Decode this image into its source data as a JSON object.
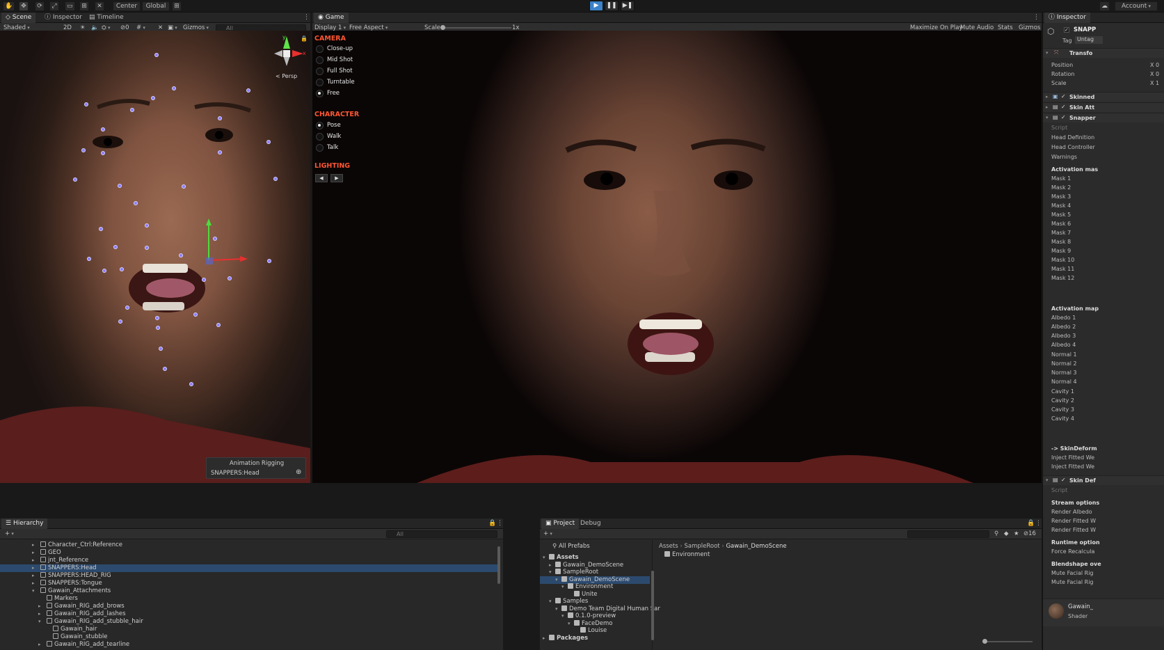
{
  "topbar": {
    "center_label": "Center",
    "global_label": "Global",
    "account_label": "Account"
  },
  "scene_tabs": [
    "Scene",
    "Inspector",
    "Timeline"
  ],
  "scene_toolbar": {
    "shading": "Shaded",
    "mode2d": "2D",
    "gizmo_count": "0",
    "gizmos": "Gizmos",
    "search_placeholder": "All"
  },
  "scene_view": {
    "persp_label": "Persp",
    "axis_y": "y",
    "axis_x": "x",
    "overlay_title": "Animation Rigging",
    "overlay_item": "SNAPPERS:Head"
  },
  "game_tab": "Game",
  "game_toolbar": {
    "display": "Display 1",
    "aspect": "Free Aspect",
    "scale_label": "Scale",
    "scale_value": "1x",
    "maximize": "Maximize On Play",
    "mute": "Mute Audio",
    "stats": "Stats",
    "gizmos": "Gizmos"
  },
  "overlay_menu": {
    "camera_header": "CAMERA",
    "camera_options": [
      "Close-up",
      "Mid Shot",
      "Full Shot",
      "Turntable",
      "Free"
    ],
    "camera_selected": 4,
    "character_header": "CHARACTER",
    "character_options": [
      "Pose",
      "Walk",
      "Talk"
    ],
    "character_selected": 0,
    "lighting_header": "LIGHTING"
  },
  "inspector": {
    "tab": "Inspector",
    "object_name": "SNAPP",
    "tag_label": "Tag",
    "tag_value": "Untag",
    "transform": "Transfo",
    "position": "Position",
    "rotation": "Rotation",
    "scale": "Scale",
    "pos_x": "X 0",
    "rot_x": "X 0",
    "scale_x": "X 1",
    "components": [
      "Skinned",
      "Skin Att",
      "Snapper"
    ],
    "script_label": "Script",
    "fields": [
      "Head Definition",
      "Head Controller",
      "Warnings"
    ],
    "activation_masks_header": "Activation mas",
    "masks": [
      "Mask 1",
      "Mask 2",
      "Mask 3",
      "Mask 4",
      "Mask 5",
      "Mask 6",
      "Mask 7",
      "Mask 8",
      "Mask 9",
      "Mask 10",
      "Mask 11",
      "Mask 12"
    ],
    "activation_maps_header": "Activation map",
    "albedo": [
      "Albedo 1",
      "Albedo 2",
      "Albedo 3",
      "Albedo 4"
    ],
    "normal": [
      "Normal 1",
      "Normal 2",
      "Normal 3",
      "Normal 4"
    ],
    "cavity": [
      "Cavity 1",
      "Cavity 2",
      "Cavity 3",
      "Cavity 4"
    ],
    "skin_deform": "-> SkinDeform",
    "inject1": "Inject Fitted We",
    "inject2": "Inject Fitted We",
    "skin_def_component": "Skin Def",
    "script2": "Script",
    "stream_options": "Stream options",
    "render_albedo": "Render Albedo",
    "render_fitted1": "Render Fitted W",
    "render_fitted2": "Render Fitted W",
    "runtime_options": "Runtime option",
    "force_recalc": "Force Recalcula",
    "blendshape": "Blendshape ove",
    "mute_facial1": "Mute Facial Rig",
    "mute_facial2": "Mute Facial Rig",
    "asset_name": "Gawain_",
    "shader_label": "Shader"
  },
  "hierarchy": {
    "tab": "Hierarchy",
    "search_placeholder": "All",
    "items": [
      {
        "label": "Character_Ctrl:Reference",
        "indent": 1,
        "type": "cube"
      },
      {
        "label": "GEO",
        "indent": 1,
        "type": "cube"
      },
      {
        "label": "jnt_Reference",
        "indent": 1,
        "type": "cube"
      },
      {
        "label": "SNAPPERS:Head",
        "indent": 1,
        "type": "cube"
      },
      {
        "label": "SNAPPERS:HEAD_RIG",
        "indent": 1,
        "type": "cube"
      },
      {
        "label": "SNAPPERS:Tongue",
        "indent": 1,
        "type": "cube"
      },
      {
        "label": "Gawain_Attachments",
        "indent": 1,
        "type": "cube"
      },
      {
        "label": "Markers",
        "indent": 2,
        "type": "cube"
      },
      {
        "label": "Gawain_RIG_add_brows",
        "indent": 2,
        "type": "cube"
      },
      {
        "label": "Gawain_RIG_add_lashes",
        "indent": 2,
        "type": "cube"
      },
      {
        "label": "Gawain_RIG_add_stubble_hair",
        "indent": 2,
        "type": "cube"
      },
      {
        "label": "Gawain_hair",
        "indent": 3,
        "type": "cube"
      },
      {
        "label": "Gawain_stubble",
        "indent": 3,
        "type": "cube"
      },
      {
        "label": "Gawain_RIG_add_tearline",
        "indent": 2,
        "type": "cube"
      }
    ],
    "selected_index": 3
  },
  "project": {
    "tabs": [
      "Project",
      "Debug"
    ],
    "all_prefabs": "All Prefabs",
    "tree": [
      {
        "label": "Assets",
        "indent": 0,
        "bold": true
      },
      {
        "label": "Gawain_DemoScene",
        "indent": 1
      },
      {
        "label": "SampleRoot",
        "indent": 1
      },
      {
        "label": "Gawain_DemoScene",
        "indent": 2
      },
      {
        "label": "Environment",
        "indent": 3
      },
      {
        "label": "Unite",
        "indent": 4
      },
      {
        "label": "Samples",
        "indent": 1
      },
      {
        "label": "Demo Team Digital Human Sar",
        "indent": 2
      },
      {
        "label": "0.1.0-preview",
        "indent": 3
      },
      {
        "label": "FaceDemo",
        "indent": 4
      },
      {
        "label": "Louise",
        "indent": 5
      },
      {
        "label": "Packages",
        "indent": 0,
        "bold": true
      }
    ],
    "tree_selected": 3,
    "breadcrumb": [
      "Assets",
      "SampleRoot",
      "Gawain_DemoScene"
    ],
    "content_items": [
      "Environment"
    ],
    "count_badge": "16"
  }
}
